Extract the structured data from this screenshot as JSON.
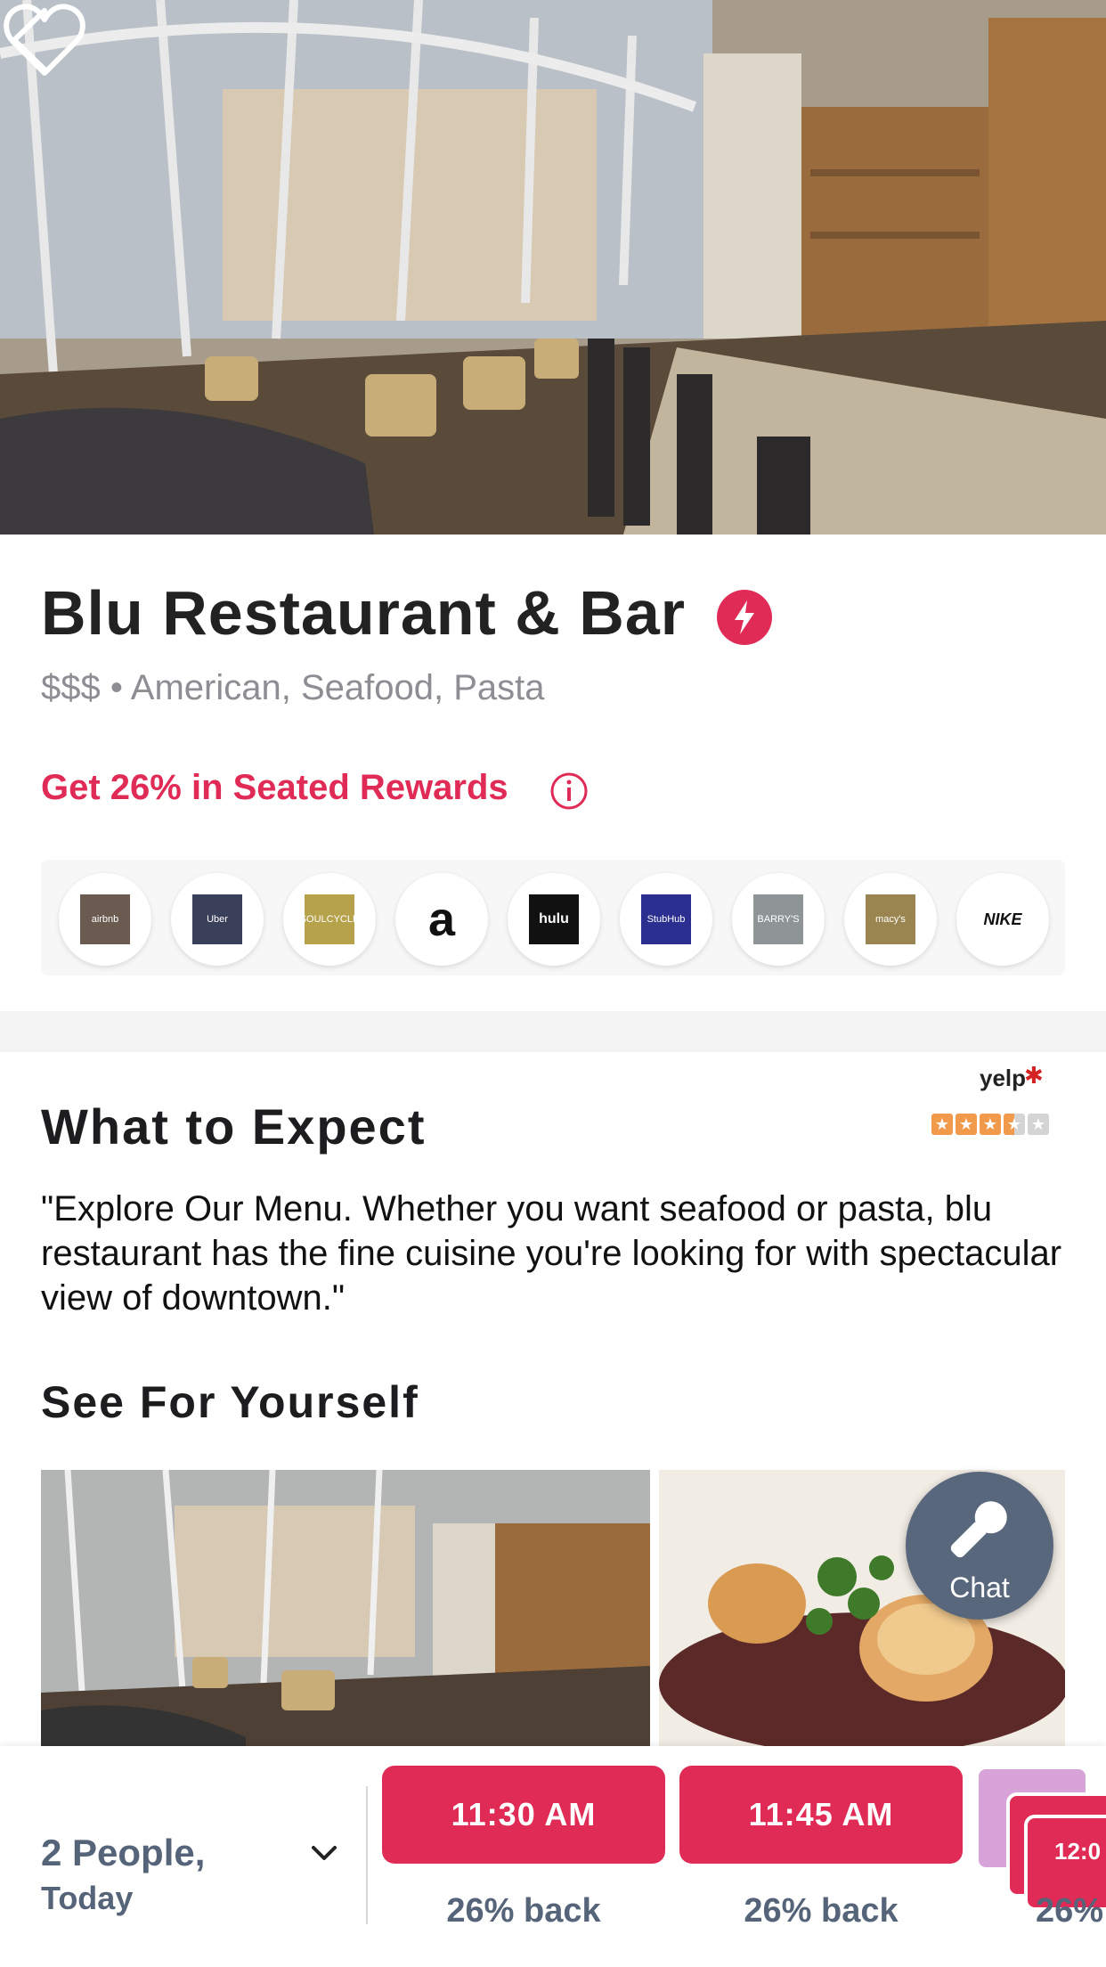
{
  "hero": {
    "back_icon": "chevron-left-icon",
    "favorite_icon": "heart-outline-icon"
  },
  "restaurant": {
    "name": "Blu Restaurant & Bar",
    "badge_icon": "lightning-bolt-icon",
    "price": "$$$",
    "separator": "•",
    "cuisines": "American, Seafood, Pasta",
    "rewards_text": "Get 26% in Seated Rewards",
    "info_icon": "info-icon"
  },
  "brands": [
    {
      "name": "airbnb",
      "label": "airbnb",
      "bg": "#6a5a50"
    },
    {
      "name": "uber",
      "label": "Uber",
      "bg": "#3a3f5a"
    },
    {
      "name": "soulcycle",
      "label": "SOULCYCLE",
      "bg": "#b7a24c"
    },
    {
      "name": "amazon",
      "label": "a",
      "bg": "#ffffff"
    },
    {
      "name": "hulu",
      "label": "hulu",
      "bg": "#111111"
    },
    {
      "name": "stubhub",
      "label": "StubHub",
      "bg": "#2b2f8f"
    },
    {
      "name": "barrys",
      "label": "BARRY'S",
      "bg": "#8f9496"
    },
    {
      "name": "macys",
      "label": "macy's",
      "bg": "#9a8450"
    },
    {
      "name": "nike",
      "label": "NIKE",
      "bg": "#ffffff"
    }
  ],
  "review": {
    "source": "yelp",
    "rating": 3.5,
    "max_rating": 5,
    "star_color": "#f29a4b"
  },
  "expect": {
    "heading": "What to Expect",
    "quote": "\"Explore Our Menu. Whether you want seafood or pasta, blu restaurant has the fine cuisine you're looking for with spectacular view of downtown.\""
  },
  "gallery": {
    "heading": "See For Yourself"
  },
  "chat": {
    "label": "Chat",
    "icon": "microphone-icon"
  },
  "booking": {
    "party_line1": "2 People,",
    "party_line2": "Today",
    "slots": [
      {
        "time": "11:30 AM",
        "back": "26% back"
      },
      {
        "time": "11:45 AM",
        "back": "26% back"
      },
      {
        "time": "12:0",
        "back": "26%"
      }
    ]
  },
  "colors": {
    "accent": "#e02b56",
    "muted": "#56647a",
    "chat_bg": "#58677c"
  }
}
